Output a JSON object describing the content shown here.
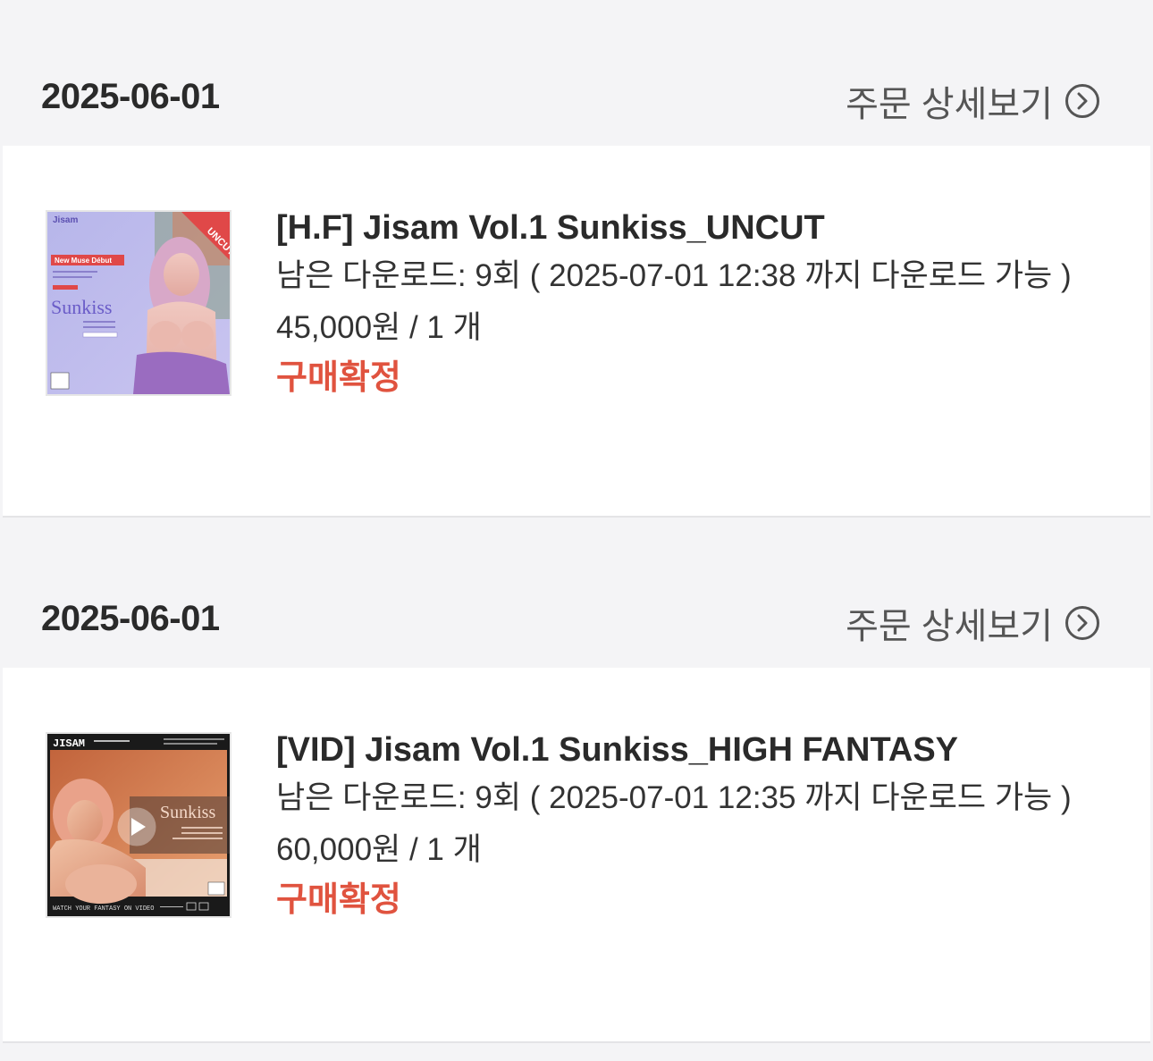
{
  "orders": [
    {
      "date": "2025-06-01",
      "detail_label": "주문 상세보기",
      "product": {
        "title": "[H.F] Jisam Vol.1 Sunkiss_UNCUT",
        "downloads_text": "남은 다운로드: 9회 ( 2025-07-01 12:38 까지 다운로드 가능 )",
        "price_text": "45,000원 / 1 개",
        "status": "구매확정",
        "thumb": {
          "brand": "Jisam",
          "badge": "UNCUT",
          "tagline": "New Muse Début",
          "name": "Sunkiss"
        }
      }
    },
    {
      "date": "2025-06-01",
      "detail_label": "주문 상세보기",
      "product": {
        "title": "[VID] Jisam Vol.1 Sunkiss_HIGH FANTASY",
        "downloads_text": "남은 다운로드: 9회 ( 2025-07-01 12:35 까지 다운로드 가능 )",
        "price_text": "60,000원 / 1 개",
        "status": "구매확정",
        "thumb": {
          "brand": "JISAM",
          "name": "Sunkiss",
          "footer": "WATCH YOUR FANTASY ON VIDEO"
        }
      }
    }
  ],
  "colors": {
    "background": "#f4f4f6",
    "card": "#ffffff",
    "status": "#e0533f",
    "text": "#2a2a2a",
    "muted": "#555555"
  },
  "icons": {
    "detail": "chevron-right-circle-icon",
    "play": "play-icon"
  }
}
